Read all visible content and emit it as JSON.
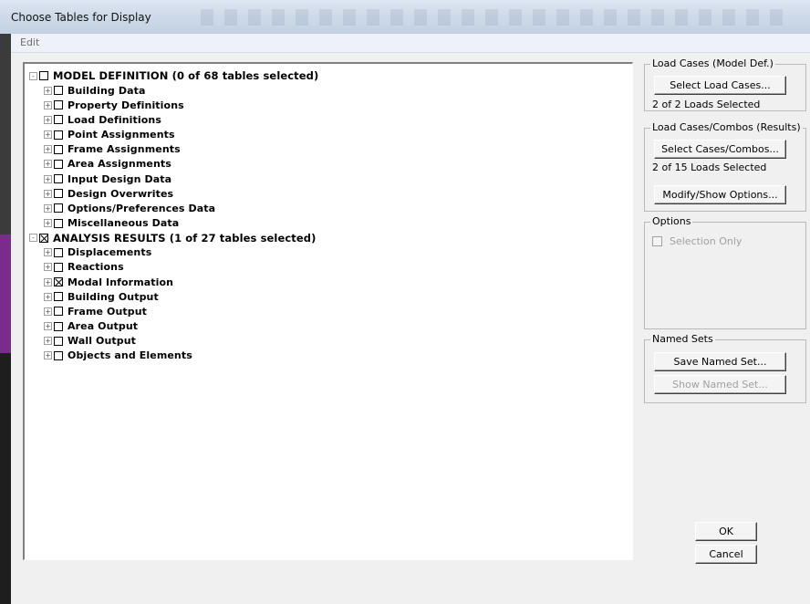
{
  "window": {
    "title": "Choose Tables for Display"
  },
  "menu": {
    "edit": "Edit"
  },
  "tree": [
    {
      "label": "MODEL DEFINITION  (0 of 68 tables selected)",
      "level": 0,
      "checked": false,
      "expander": "-"
    },
    {
      "label": "Building Data",
      "level": 1,
      "checked": false,
      "expander": "+"
    },
    {
      "label": "Property Definitions",
      "level": 1,
      "checked": false,
      "expander": "+"
    },
    {
      "label": "Load Definitions",
      "level": 1,
      "checked": false,
      "expander": "+"
    },
    {
      "label": "Point Assignments",
      "level": 1,
      "checked": false,
      "expander": "+"
    },
    {
      "label": "Frame Assignments",
      "level": 1,
      "checked": false,
      "expander": "+"
    },
    {
      "label": "Area Assignments",
      "level": 1,
      "checked": false,
      "expander": "+"
    },
    {
      "label": "Input Design Data",
      "level": 1,
      "checked": false,
      "expander": "+"
    },
    {
      "label": "Design Overwrites",
      "level": 1,
      "checked": false,
      "expander": "+"
    },
    {
      "label": "Options/Preferences Data",
      "level": 1,
      "checked": false,
      "expander": "+"
    },
    {
      "label": "Miscellaneous Data",
      "level": 1,
      "checked": false,
      "expander": "+"
    },
    {
      "label": "ANALYSIS RESULTS  (1 of 27 tables selected)",
      "level": 0,
      "checked": true,
      "expander": "-"
    },
    {
      "label": "Displacements",
      "level": 1,
      "checked": false,
      "expander": "+"
    },
    {
      "label": "Reactions",
      "level": 1,
      "checked": false,
      "expander": "+"
    },
    {
      "label": "Modal Information",
      "level": 1,
      "checked": true,
      "expander": "+"
    },
    {
      "label": "Building Output",
      "level": 1,
      "checked": false,
      "expander": "+"
    },
    {
      "label": "Frame Output",
      "level": 1,
      "checked": false,
      "expander": "+"
    },
    {
      "label": "Area Output",
      "level": 1,
      "checked": false,
      "expander": "+"
    },
    {
      "label": "Wall Output",
      "level": 1,
      "checked": false,
      "expander": "+"
    },
    {
      "label": "Objects and Elements",
      "level": 1,
      "checked": false,
      "expander": "+"
    }
  ],
  "load_cases_model": {
    "legend": "Load Cases (Model Def.)",
    "button": "Select Load Cases...",
    "status": "2  of  2  Loads Selected"
  },
  "load_cases_results": {
    "legend": "Load Cases/Combos (Results)",
    "button": "Select Cases/Combos...",
    "status": "2  of  15  Loads Selected",
    "options_button": "Modify/Show Options..."
  },
  "options": {
    "legend": "Options",
    "selection_only": "Selection Only"
  },
  "named_sets": {
    "legend": "Named Sets",
    "save": "Save Named Set...",
    "show": "Show Named Set..."
  },
  "actions": {
    "ok": "OK",
    "cancel": "Cancel"
  }
}
